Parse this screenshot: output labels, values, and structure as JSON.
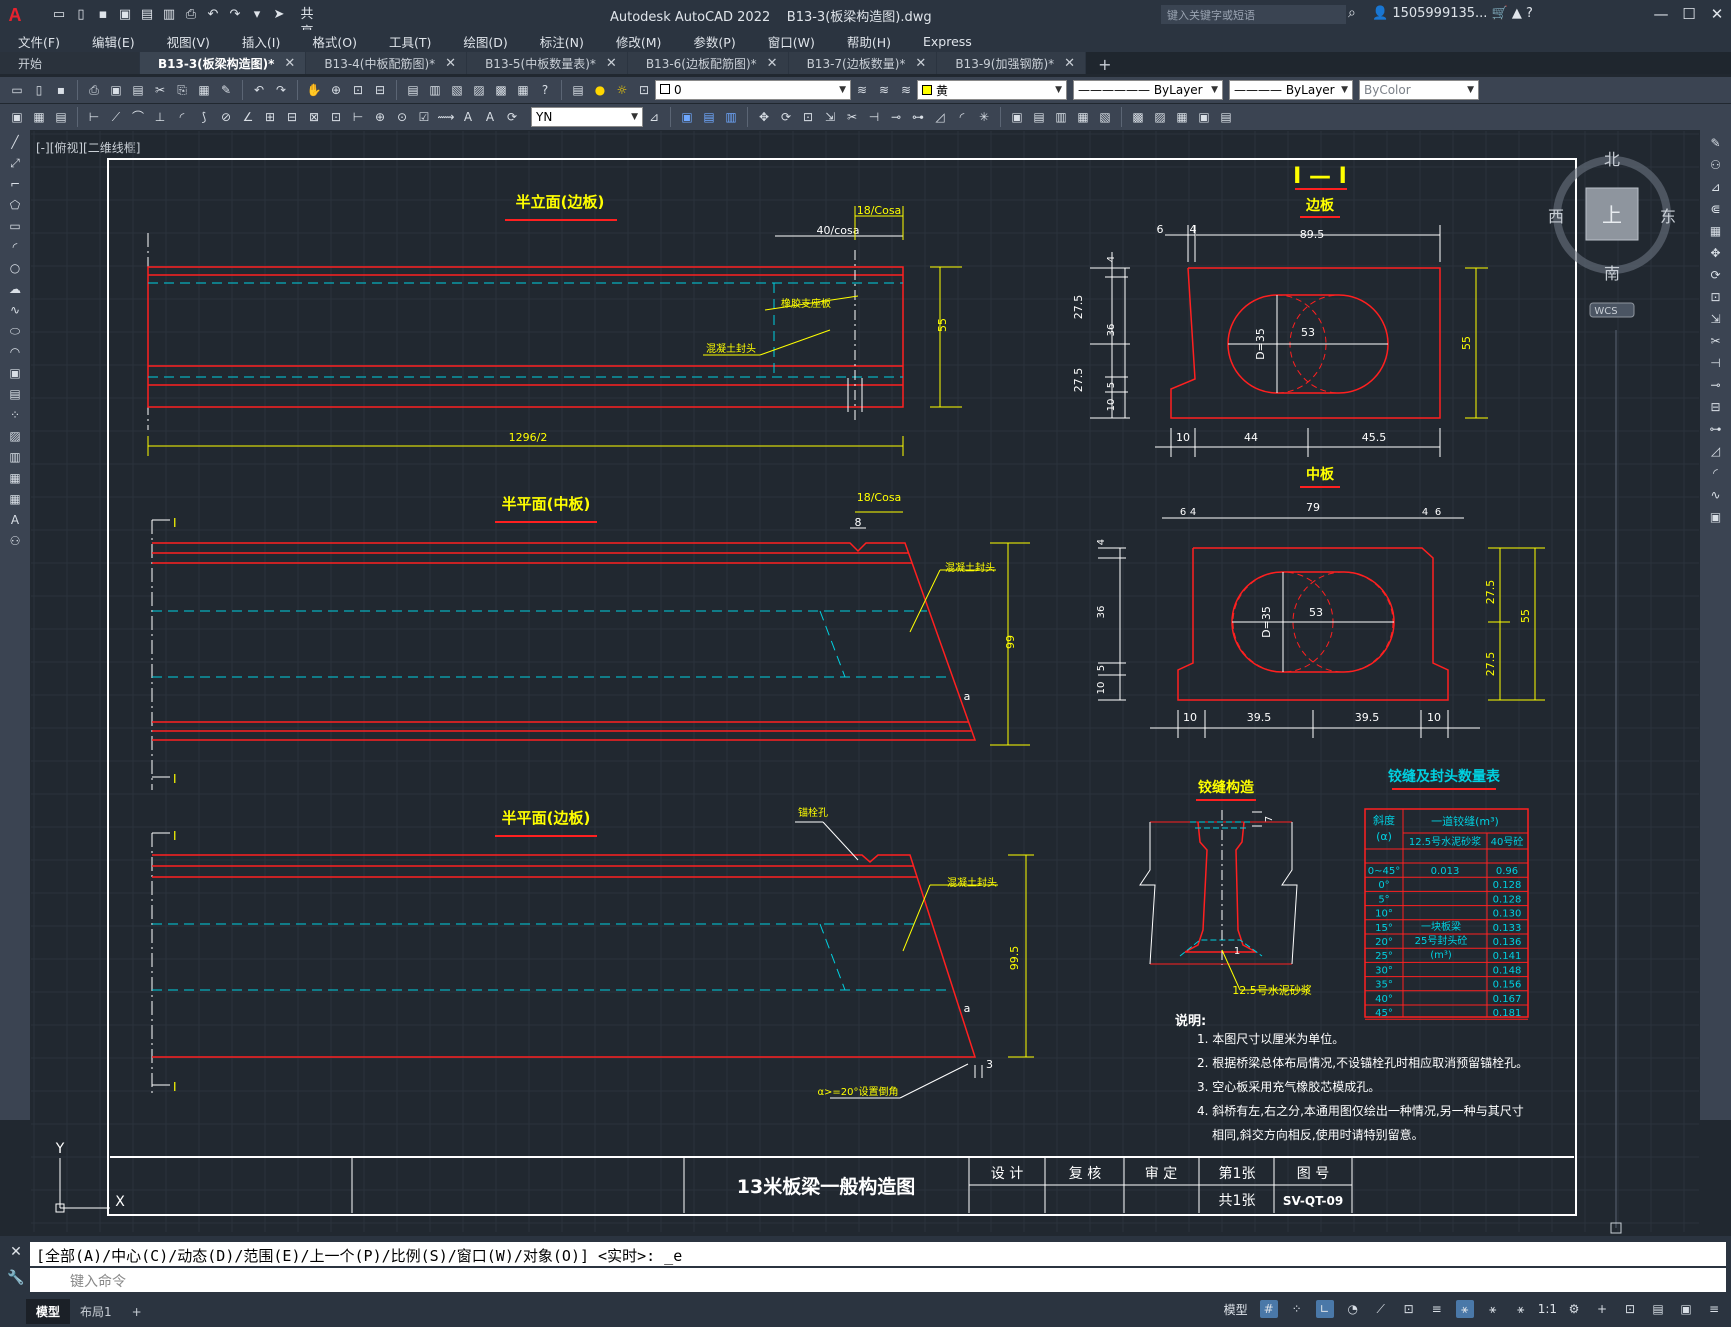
{
  "app": {
    "title": "Autodesk AutoCAD 2022",
    "file": "B13-3(板梁构造图).dwg",
    "share": "共享",
    "search_placeholder": "键入关键字或短语",
    "user": "1505999135..."
  },
  "menu": [
    "文件(F)",
    "编辑(E)",
    "视图(V)",
    "插入(I)",
    "格式(O)",
    "工具(T)",
    "绘图(D)",
    "标注(N)",
    "修改(M)",
    "参数(P)",
    "窗口(W)",
    "帮助(H)",
    "Express"
  ],
  "tabs": [
    {
      "label": "开始",
      "active": false
    },
    {
      "label": "B13-3(板梁构造图)*",
      "active": true
    },
    {
      "label": "B13-4(中板配筋图)*",
      "active": false
    },
    {
      "label": "B13-5(中板数量表)*",
      "active": false
    },
    {
      "label": "B13-6(边板配筋图)*",
      "active": false
    },
    {
      "label": "B13-7(边板数量)*",
      "active": false
    },
    {
      "label": "B13-9(加强钢筋)*",
      "active": false
    }
  ],
  "toolbar": {
    "layer_value": "0",
    "color_value": "黄",
    "linetype_value": "ByLayer",
    "lineweight_value": "ByLayer",
    "plotstyle_value": "ByColor",
    "dimstyle_value": "YN"
  },
  "viewport": {
    "label": "[-][俯视][二维线框]"
  },
  "viewcube": {
    "north": "北",
    "south": "南",
    "east": "东",
    "west": "西",
    "top": "上",
    "wcs": "WCS"
  },
  "drawing": {
    "titles": {
      "half_elevation": "半立面(边板)",
      "half_plan_mid": "半平面(中板)",
      "half_plan_edge": "半平面(边板)",
      "section": "I — I",
      "edge_board": "边板",
      "mid_board": "中板",
      "hinge": "铰缝构造",
      "table_title": "铰缝及封头数量表"
    },
    "dims": {
      "d_18cosa": "18/Cosa",
      "d_40cosa": "40/cosa",
      "d_55": "55",
      "d_1296": "1296/2",
      "d_8": "8",
      "d_99": "99",
      "d_995": "99.5",
      "d_a": "a",
      "d_3": "3",
      "d_6": "6",
      "d_4": "4",
      "d_895": "89.5",
      "d_275": "27.5",
      "d_36": "36",
      "d_5": "5",
      "d_10": "10",
      "d_44": "44",
      "d_455": "45.5",
      "d_79": "79",
      "d_395": "39.5",
      "d_35": "D=35",
      "d_53": "53",
      "d_7": "7",
      "d_1": "1"
    },
    "labels": {
      "support": "橡胶支座板",
      "seal": "混凝土封头",
      "anchor": "锚栓孔",
      "alpha_note": "α>=20°设置倒角",
      "mortar": "12.5号水泥砂浆"
    },
    "notes": {
      "heading": "说明:",
      "items": [
        "1. 本图尺寸以厘米为单位。",
        "2. 根据桥梁总体布局情况,不设锚栓孔时相应取消预留锚栓孔。",
        "3. 空心板采用充气橡胶芯模成孔。",
        "4. 斜桥有左,右之分,本通用图仅绘出一种情况,另一种与其尺寸",
        "相同,斜交方向相反,使用时请特别留意。"
      ]
    },
    "table": {
      "col1": "斜度",
      "col1b": "(α)",
      "col2": "一道铰缝(m³)",
      "col2a": "12.5号水泥砂浆",
      "col2b": "40号砼",
      "side_note": [
        "一块板梁",
        "25号封头砼",
        "(m³)"
      ],
      "rows": [
        {
          "angle": "0~45°",
          "mortar": "0.013",
          "concrete": "0.96"
        },
        {
          "angle": "0°",
          "mortar": "",
          "concrete": "0.128"
        },
        {
          "angle": "5°",
          "mortar": "",
          "concrete": "0.128"
        },
        {
          "angle": "10°",
          "mortar": "",
          "concrete": "0.130"
        },
        {
          "angle": "15°",
          "mortar": "",
          "concrete": "0.133"
        },
        {
          "angle": "20°",
          "mortar": "",
          "concrete": "0.136"
        },
        {
          "angle": "25°",
          "mortar": "",
          "concrete": "0.141"
        },
        {
          "angle": "30°",
          "mortar": "",
          "concrete": "0.148"
        },
        {
          "angle": "35°",
          "mortar": "",
          "concrete": "0.156"
        },
        {
          "angle": "40°",
          "mortar": "",
          "concrete": "0.167"
        },
        {
          "angle": "45°",
          "mortar": "",
          "concrete": "0.181"
        }
      ]
    },
    "titleblock": {
      "drawing_name": "13米板梁一般构造图",
      "design": "设 计",
      "review": "复 核",
      "approve": "审 定",
      "sheet": "第1张",
      "total": "共1张",
      "fig_no_label": "图 号",
      "fig_no": "SV-QT-09"
    },
    "section_marks": {
      "I": "I"
    }
  },
  "command": {
    "history": "[全部(A)/中心(C)/动态(D)/范围(E)/上一个(P)/比例(S)/窗口(W)/对象(O)] <实时>: _e",
    "placeholder": "键入命令"
  },
  "status": {
    "layouts": [
      "模型",
      "布局1"
    ],
    "model_label": "模型",
    "scale": "1:1"
  },
  "ucs": {
    "x": "X",
    "y": "Y"
  },
  "colors": {
    "background": "#212830",
    "red": "#ff2020",
    "yellow": "#ffff00",
    "cyan": "#00d0e0",
    "white": "#ffffff"
  }
}
